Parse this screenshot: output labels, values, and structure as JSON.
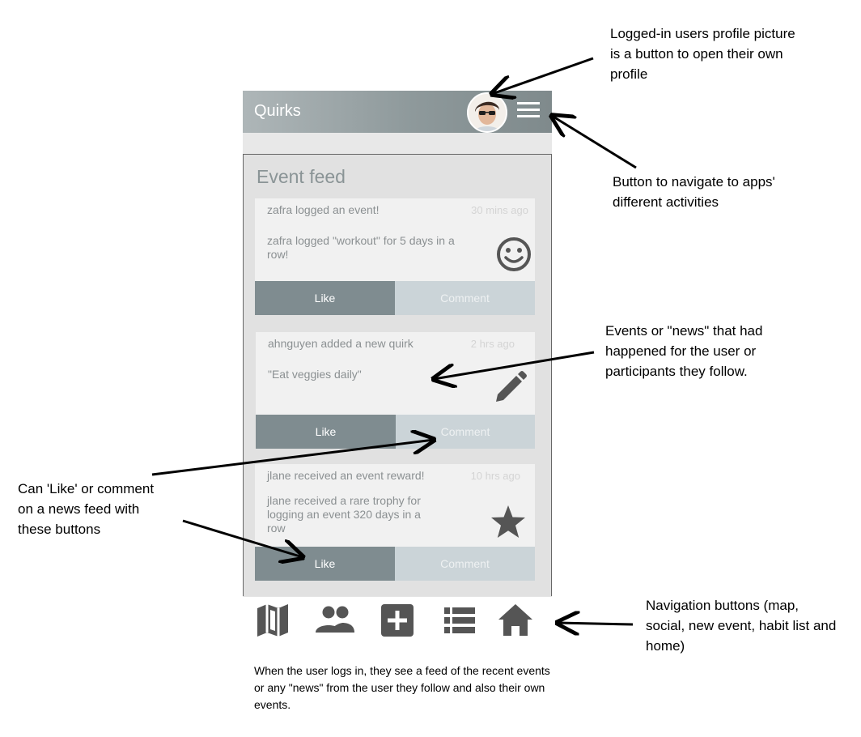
{
  "app": {
    "title": "Quirks",
    "feed_title": "Event feed"
  },
  "feed": [
    {
      "header": "zafra logged an event!",
      "time": "30 mins ago",
      "body": "zafra logged \"workout\" for 5 days in a row!",
      "icon": "smiley-icon",
      "like_label": "Like",
      "comment_label": "Comment"
    },
    {
      "header": "ahnguyen added a new quirk",
      "time": "2 hrs ago",
      "body": "\"Eat veggies daily\"",
      "icon": "pencil-icon",
      "like_label": "Like",
      "comment_label": "Comment"
    },
    {
      "header": "jlane received an event reward!",
      "time": "10 hrs ago",
      "body": "jlane received a rare trophy for logging an event 320 days in a row",
      "icon": "star-icon",
      "like_label": "Like",
      "comment_label": "Comment"
    }
  ],
  "nav": [
    "map-icon",
    "social-icon",
    "new-event-icon",
    "habit-list-icon",
    "home-icon"
  ],
  "annotations": {
    "profile": "Logged-in users profile picture is a button to open their own profile",
    "menu": "Button to navigate to apps' different activities",
    "events": "Events or \"news\" that had happened for the user or participants they follow.",
    "like": "Can 'Like' or comment on a news feed with these buttons",
    "navigation": "Navigation buttons (map, social, new event, habit list and home)"
  },
  "caption": "When the user logs in, they see a feed of the recent events or any \"news\" from the user they follow and also their own events.",
  "colors": {
    "appbar": "#8e999b",
    "like_button": "#7f8c90",
    "comment_button": "#cbd4d8",
    "icon": "#555555"
  }
}
